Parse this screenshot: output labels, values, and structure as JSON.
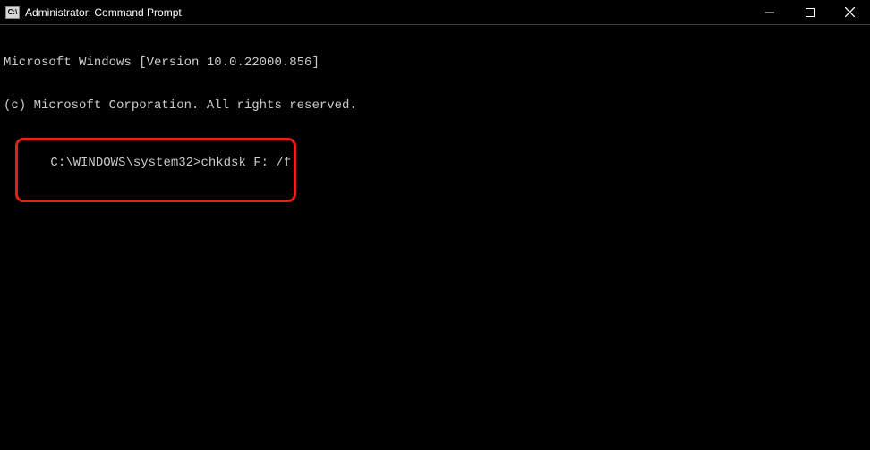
{
  "window": {
    "title": "Administrator: Command Prompt",
    "icon_label": "C:\\"
  },
  "terminal": {
    "line1": "Microsoft Windows [Version 10.0.22000.856]",
    "line2": "(c) Microsoft Corporation. All rights reserved.",
    "prompt": "C:\\WINDOWS\\system32>",
    "command": "chkdsk F: /f"
  }
}
